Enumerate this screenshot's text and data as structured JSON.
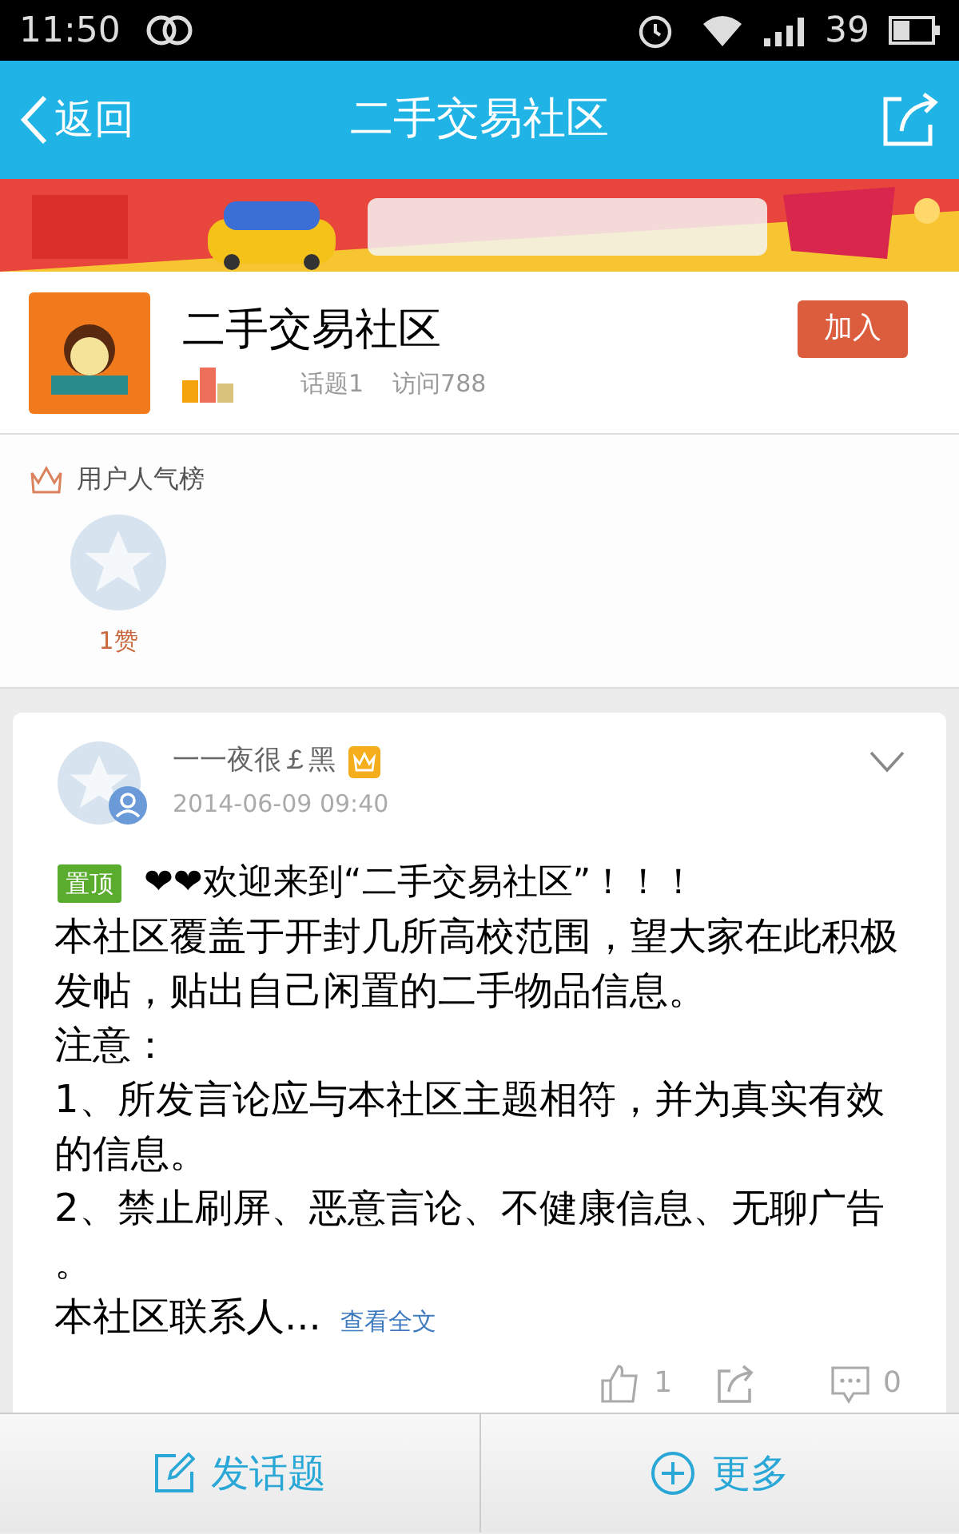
{
  "status_bar": {
    "time": "11:50",
    "battery": "39"
  },
  "header": {
    "back": "返回",
    "title": "二手交易社区"
  },
  "community": {
    "name": "二手交易社区",
    "join": "加入",
    "topics": "话题1",
    "visits": "访问788"
  },
  "ranking": {
    "title": "用户人气榜",
    "users": [
      {
        "likes": "1赞"
      }
    ]
  },
  "post": {
    "author": "一一夜很￡黑",
    "time": "2014-06-09 09:40",
    "pinned": "置顶",
    "title": "❤❤欢迎来到“二手交易社区”！！！",
    "lines": [
      "本社区覆盖于开封几所高校范围，望大家在此积极",
      "发帖，贴出自己闲置的二手物品信息。",
      "注意：",
      "1、所发言论应与本社区主题相符，并为真实有效",
      "的信息。",
      "2、禁止刷屏、恶意言论、不健康信息、无聊广告",
      "。"
    ],
    "last_line": "本社区联系人...",
    "more": "查看全文",
    "likes": "1",
    "comments": "0"
  },
  "bottom_bar": [
    {
      "kind": "post",
      "label": "发话题"
    },
    {
      "kind": "more",
      "label": "更多"
    }
  ]
}
